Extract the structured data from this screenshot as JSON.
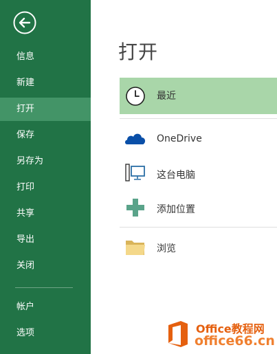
{
  "sidebar": {
    "items": [
      {
        "label": "信息"
      },
      {
        "label": "新建"
      },
      {
        "label": "打开"
      },
      {
        "label": "保存"
      },
      {
        "label": "另存为"
      },
      {
        "label": "打印"
      },
      {
        "label": "共享"
      },
      {
        "label": "导出"
      },
      {
        "label": "关闭"
      },
      {
        "label": "帐户"
      },
      {
        "label": "选项"
      }
    ],
    "active_item": "打开"
  },
  "main": {
    "title": "打开",
    "locations": [
      {
        "label": "最近",
        "icon": "clock-icon"
      },
      {
        "label": "OneDrive",
        "icon": "onedrive-cloud-icon"
      },
      {
        "label": "这台电脑",
        "icon": "computer-icon"
      },
      {
        "label": "添加位置",
        "icon": "plus-icon"
      },
      {
        "label": "浏览",
        "icon": "folder-icon"
      }
    ]
  },
  "watermark": {
    "line1": "Office教程网",
    "line2": "office66.cn"
  },
  "colors": {
    "sidebar_bg": "#217346",
    "sidebar_active": "#439467",
    "recent_highlight": "#a9d6a9",
    "onedrive_blue": "#0a4fa8",
    "plus_green": "#5aa38a",
    "watermark_orange": "#e5600f"
  }
}
